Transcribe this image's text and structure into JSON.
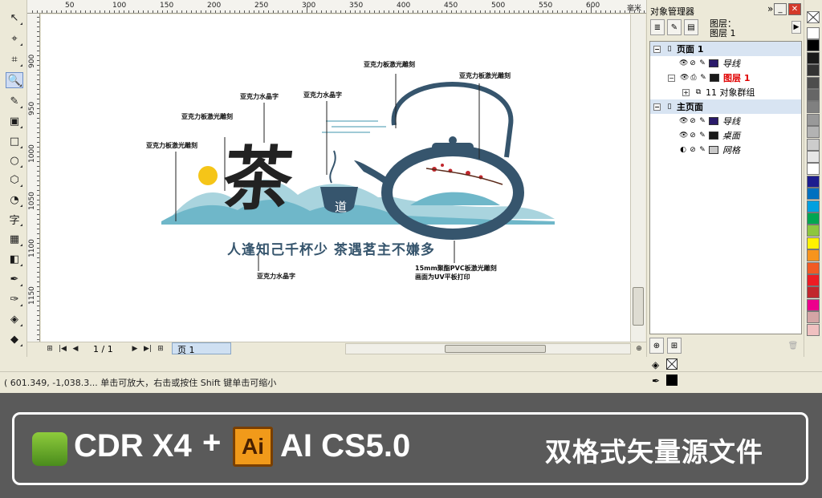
{
  "ruler": {
    "unit": "毫米",
    "top_labels": [
      "50",
      "100",
      "150",
      "200",
      "250",
      "300",
      "350",
      "400",
      "450",
      "500",
      "550",
      "600"
    ],
    "left_labels": [
      "900",
      "950",
      "1000",
      "1050",
      "1100",
      "1150"
    ]
  },
  "toolbox": {
    "tools": [
      {
        "name": "pick-tool-icon",
        "glyph": "↖"
      },
      {
        "name": "shape-tool-icon",
        "glyph": "⌖"
      },
      {
        "name": "crop-tool-icon",
        "glyph": "⌗"
      },
      {
        "name": "zoom-tool-icon",
        "glyph": "🔍"
      },
      {
        "name": "freehand-tool-icon",
        "glyph": "✎"
      },
      {
        "name": "smart-fill-tool-icon",
        "glyph": "▣"
      },
      {
        "name": "rectangle-tool-icon",
        "glyph": "□"
      },
      {
        "name": "ellipse-tool-icon",
        "glyph": "○"
      },
      {
        "name": "polygon-tool-icon",
        "glyph": "⬡"
      },
      {
        "name": "basic-shapes-tool-icon",
        "glyph": "◔"
      },
      {
        "name": "text-tool-icon",
        "glyph": "字"
      },
      {
        "name": "table-tool-icon",
        "glyph": "▦"
      },
      {
        "name": "interactive-blend-tool-icon",
        "glyph": "◧"
      },
      {
        "name": "eyedropper-tool-icon",
        "glyph": "✒"
      },
      {
        "name": "outline-tool-icon",
        "glyph": "✑"
      },
      {
        "name": "fill-tool-icon",
        "glyph": "◈"
      },
      {
        "name": "interactive-fill-tool-icon",
        "glyph": "◆"
      }
    ]
  },
  "page_nav": {
    "page_count": "1 / 1",
    "page_tab": "页 1"
  },
  "status": {
    "text": "( 601.349, -1,038.3...    单击可放大，右击或按住 Shift 键单击可缩小"
  },
  "docker": {
    "title": "对象管理器",
    "layer_label": "图层：",
    "layer_value": "图层 1",
    "tree": [
      {
        "kind": "page",
        "label": "页面 1"
      },
      {
        "kind": "layer",
        "label": "导线",
        "italic": true,
        "color": "#2a1a6a"
      },
      {
        "kind": "layer",
        "label": "图层 1",
        "red": true,
        "color": "#1a1a1a"
      },
      {
        "kind": "object",
        "label": "11 对象群组"
      },
      {
        "kind": "page",
        "label": "主页面"
      },
      {
        "kind": "layer",
        "label": "导线",
        "italic": true,
        "color": "#2a1a6a"
      },
      {
        "kind": "layer",
        "label": "桌面",
        "italic": true,
        "color": "#1a1a1a"
      },
      {
        "kind": "layer",
        "label": "网格",
        "italic": true,
        "color": "#c8c8c8"
      }
    ]
  },
  "palette": {
    "colors": [
      "#ffffff",
      "#000000",
      "#1a1a1a",
      "#333333",
      "#4d4d4d",
      "#666666",
      "#808080",
      "#999999",
      "#b3b3b3",
      "#cccccc",
      "#e6e6e6",
      "#ffffff",
      "#1d1d8f",
      "#0070c0",
      "#00a0e0",
      "#00a651",
      "#8dc63f",
      "#fff200",
      "#f7941d",
      "#f15a24",
      "#ed1c24",
      "#c1272d",
      "#ec008c",
      "#d4a5a5",
      "#f0c0c0"
    ]
  },
  "artwork": {
    "tea": "茶",
    "dao": "道",
    "slogan": "人逢知己千杯少  茶遇茗主不嫌多",
    "callouts": [
      "亚克力板激光雕刻",
      "亚克力板激光雕刻",
      "亚克力水晶字",
      "亚克力板激光雕刻",
      "亚克力水晶字",
      "亚克力板激光雕刻",
      "亚克力水晶字",
      "15mm聚酯PVC板激光雕刻",
      "画面为UV平板打印"
    ]
  },
  "banner": {
    "cdr_text": "CDR X4",
    "plus": "+",
    "ai_logo": "Ai",
    "ai_text": "AI CS5.0",
    "tagline": "双格式矢量源文件"
  },
  "colors": {
    "teal": "#6fb7c9",
    "slate": "#36556d",
    "sun": "#f5c518",
    "band": "#5a5a5a"
  }
}
